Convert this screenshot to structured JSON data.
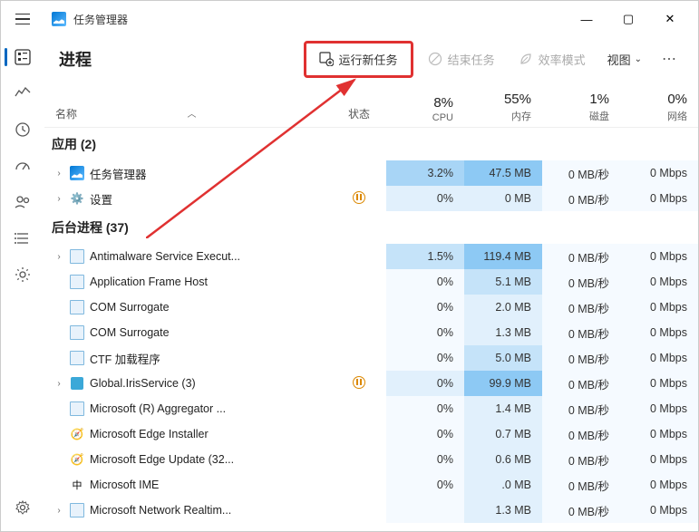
{
  "app": {
    "title": "任务管理器"
  },
  "window": {
    "minimize": "—",
    "maximize": "▢",
    "close": "✕"
  },
  "toolbar": {
    "page_title": "进程",
    "run_new_task": "运行新任务",
    "end_task": "结束任务",
    "efficiency_mode": "效率模式",
    "view": "视图"
  },
  "headers": {
    "name": "名称",
    "status": "状态",
    "cpu_pct": "8%",
    "cpu_label": "CPU",
    "mem_pct": "55%",
    "mem_label": "内存",
    "disk_pct": "1%",
    "disk_label": "磁盘",
    "net_pct": "0%",
    "net_label": "网络"
  },
  "groups": {
    "apps": "应用 (2)",
    "background": "后台进程 (37)"
  },
  "rows": [
    {
      "exp": "›",
      "icon": "task-manager",
      "name": "任务管理器",
      "status": "",
      "cpu": "3.2%",
      "cpu_heat": 4,
      "mem": "47.5 MB",
      "mem_heat": 5,
      "disk": "0 MB/秒",
      "disk_heat": 1,
      "net": "0 Mbps",
      "net_heat": 1
    },
    {
      "exp": "›",
      "icon": "settings",
      "name": "设置",
      "status": "⏸",
      "cpu": "0%",
      "cpu_heat": 2,
      "mem": "0 MB",
      "mem_heat": 2,
      "disk": "0 MB/秒",
      "disk_heat": 1,
      "net": "0 Mbps",
      "net_heat": 1
    }
  ],
  "bg_rows": [
    {
      "exp": "›",
      "icon": "generic",
      "name": "Antimalware Service Execut...",
      "status": "",
      "cpu": "1.5%",
      "cpu_heat": 3,
      "mem": "119.4 MB",
      "mem_heat": 5,
      "disk": "0 MB/秒",
      "disk_heat": 1,
      "net": "0 Mbps",
      "net_heat": 1
    },
    {
      "exp": "",
      "icon": "generic",
      "name": "Application Frame Host",
      "status": "",
      "cpu": "0%",
      "cpu_heat": 1,
      "mem": "5.1 MB",
      "mem_heat": 3,
      "disk": "0 MB/秒",
      "disk_heat": 1,
      "net": "0 Mbps",
      "net_heat": 1
    },
    {
      "exp": "",
      "icon": "generic",
      "name": "COM Surrogate",
      "status": "",
      "cpu": "0%",
      "cpu_heat": 1,
      "mem": "2.0 MB",
      "mem_heat": 2,
      "disk": "0 MB/秒",
      "disk_heat": 1,
      "net": "0 Mbps",
      "net_heat": 1
    },
    {
      "exp": "",
      "icon": "generic",
      "name": "COM Surrogate",
      "status": "",
      "cpu": "0%",
      "cpu_heat": 1,
      "mem": "1.3 MB",
      "mem_heat": 2,
      "disk": "0 MB/秒",
      "disk_heat": 1,
      "net": "0 Mbps",
      "net_heat": 1
    },
    {
      "exp": "",
      "icon": "generic",
      "name": "CTF 加载程序",
      "status": "",
      "cpu": "0%",
      "cpu_heat": 1,
      "mem": "5.0 MB",
      "mem_heat": 3,
      "disk": "0 MB/秒",
      "disk_heat": 1,
      "net": "0 Mbps",
      "net_heat": 1
    },
    {
      "exp": "›",
      "icon": "iris",
      "name": "Global.IrisService (3)",
      "status": "⏸",
      "cpu": "0%",
      "cpu_heat": 2,
      "mem": "99.9 MB",
      "mem_heat": 5,
      "disk": "0 MB/秒",
      "disk_heat": 1,
      "net": "0 Mbps",
      "net_heat": 1
    },
    {
      "exp": "",
      "icon": "generic",
      "name": "Microsoft (R) Aggregator ...",
      "status": "",
      "cpu": "0%",
      "cpu_heat": 1,
      "mem": "1.4 MB",
      "mem_heat": 2,
      "disk": "0 MB/秒",
      "disk_heat": 1,
      "net": "0 Mbps",
      "net_heat": 1
    },
    {
      "exp": "",
      "icon": "edge",
      "name": "Microsoft Edge Installer",
      "status": "",
      "cpu": "0%",
      "cpu_heat": 1,
      "mem": "0.7 MB",
      "mem_heat": 2,
      "disk": "0 MB/秒",
      "disk_heat": 1,
      "net": "0 Mbps",
      "net_heat": 1
    },
    {
      "exp": "",
      "icon": "edge",
      "name": "Microsoft Edge Update (32...",
      "status": "",
      "cpu": "0%",
      "cpu_heat": 1,
      "mem": "0.6 MB",
      "mem_heat": 2,
      "disk": "0 MB/秒",
      "disk_heat": 1,
      "net": "0 Mbps",
      "net_heat": 1
    },
    {
      "exp": "",
      "icon": "ime",
      "name": "Microsoft IME",
      "status": "",
      "cpu": "0%",
      "cpu_heat": 1,
      "mem": ".0 MB",
      "mem_heat": 2,
      "disk": "0 MB/秒",
      "disk_heat": 1,
      "net": "0 Mbps",
      "net_heat": 1
    },
    {
      "exp": "›",
      "icon": "generic",
      "name": "Microsoft Network Realtim...",
      "status": "",
      "cpu": "",
      "cpu_heat": 1,
      "mem": "1.3 MB",
      "mem_heat": 2,
      "disk": "0 MB/秒",
      "disk_heat": 1,
      "net": "0 Mbps",
      "net_heat": 1
    }
  ]
}
